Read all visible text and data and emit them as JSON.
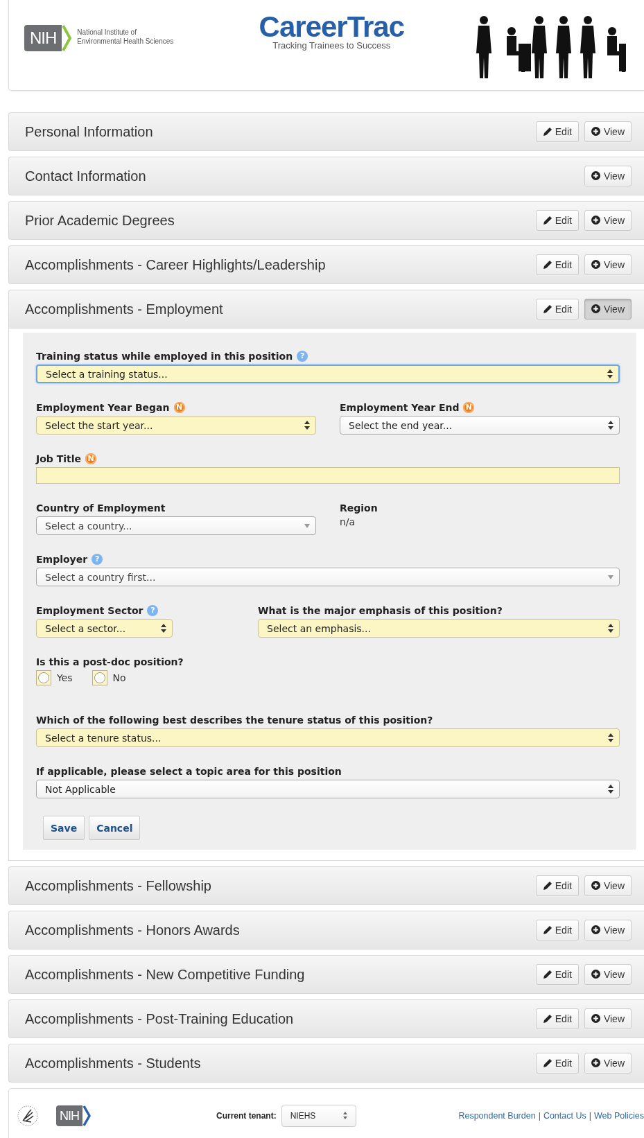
{
  "header": {
    "org_logo": "NIH",
    "org_name_lines": [
      "National Institute of",
      "Environmental Health Sciences"
    ],
    "app_title": "CareerTrac",
    "tagline": "Tracking Trainees to Success"
  },
  "sections": [
    {
      "title": "Personal Information",
      "expanded": false,
      "buttons": [
        {
          "kind": "edit",
          "label": "Edit",
          "pressed": false
        },
        {
          "kind": "view",
          "label": "View",
          "pressed": false
        }
      ]
    },
    {
      "title": "Contact Information",
      "expanded": false,
      "buttons": [
        {
          "kind": "view",
          "label": "View",
          "pressed": false
        }
      ]
    },
    {
      "title": "Prior Academic Degrees",
      "expanded": false,
      "buttons": [
        {
          "kind": "edit",
          "label": "Edit",
          "pressed": false
        },
        {
          "kind": "view",
          "label": "View",
          "pressed": false
        }
      ]
    },
    {
      "title": "Accomplishments - Career Highlights/Leadership",
      "expanded": false,
      "buttons": [
        {
          "kind": "edit",
          "label": "Edit",
          "pressed": false
        },
        {
          "kind": "view",
          "label": "View",
          "pressed": false
        }
      ]
    },
    {
      "title": "Accomplishments - Employment",
      "expanded": true,
      "buttons": [
        {
          "kind": "edit",
          "label": "Edit",
          "pressed": false
        },
        {
          "kind": "view",
          "label": "View",
          "pressed": true
        }
      ],
      "form": {
        "rows": [
          {
            "fields": [
              {
                "kind": "select",
                "label": "Training status while employed in this position",
                "marker": {
                  "kind": "help",
                  "text": "?"
                },
                "value": "Select a training status...",
                "highlighted": true,
                "focused": true
              }
            ]
          },
          {
            "fields": [
              {
                "kind": "select",
                "label": "Employment Year Began",
                "marker": {
                  "kind": "new",
                  "text": "N"
                },
                "value": "Select the start year...",
                "highlighted": true,
                "focused": false
              },
              {
                "kind": "select",
                "label": "Employment Year End",
                "marker": {
                  "kind": "new",
                  "text": "N"
                },
                "value": "Select the end year...",
                "highlighted": false,
                "focused": false
              }
            ]
          },
          {
            "fields": [
              {
                "kind": "text",
                "label": "Job Title",
                "marker": {
                  "kind": "new",
                  "text": "N"
                },
                "highlighted": true,
                "focused": false
              }
            ]
          },
          {
            "fields": [
              {
                "kind": "combo",
                "label": "Country of Employment",
                "value": "Select a country...",
                "highlighted": false,
                "focused": false
              },
              {
                "kind": "static",
                "label": "Region",
                "value": "n/a"
              }
            ]
          },
          {
            "fields": [
              {
                "kind": "combo",
                "label": "Employer",
                "marker": {
                  "kind": "help",
                  "text": "?"
                },
                "value": "Select a country first...",
                "highlighted": false,
                "focused": false
              }
            ]
          },
          {
            "fields": [
              {
                "kind": "select",
                "label": "Employment Sector",
                "marker": {
                  "kind": "help",
                  "text": "?"
                },
                "value": "Select a sector...",
                "highlighted": true,
                "focused": false
              },
              {
                "kind": "select",
                "label": "What is the major emphasis of this position?",
                "value": "Select an emphasis...",
                "highlighted": true,
                "focused": false
              }
            ]
          },
          {
            "fields": [
              {
                "kind": "radio",
                "label": "Is this a post-doc position?",
                "options": [
                  {
                    "label": "Yes",
                    "selected": false
                  },
                  {
                    "label": "No",
                    "selected": false
                  }
                ]
              }
            ]
          },
          {
            "fields": [
              {
                "kind": "select",
                "label": "Which of the following best describes the tenure status of this position?",
                "value": "Select a tenure status...",
                "highlighted": true,
                "focused": false
              }
            ]
          },
          {
            "fields": [
              {
                "kind": "select",
                "label": "If applicable, please select a topic area for this position",
                "value": "Not Applicable",
                "highlighted": false,
                "focused": false
              }
            ]
          }
        ],
        "actions": [
          {
            "label": "Save"
          },
          {
            "label": "Cancel"
          }
        ]
      }
    },
    {
      "title": "Accomplishments - Fellowship",
      "expanded": false,
      "buttons": [
        {
          "kind": "edit",
          "label": "Edit",
          "pressed": false
        },
        {
          "kind": "view",
          "label": "View",
          "pressed": false
        }
      ]
    },
    {
      "title": "Accomplishments - Honors Awards",
      "expanded": false,
      "buttons": [
        {
          "kind": "edit",
          "label": "Edit",
          "pressed": false
        },
        {
          "kind": "view",
          "label": "View",
          "pressed": false
        }
      ]
    },
    {
      "title": "Accomplishments - New Competitive Funding",
      "expanded": false,
      "buttons": [
        {
          "kind": "edit",
          "label": "Edit",
          "pressed": false
        },
        {
          "kind": "view",
          "label": "View",
          "pressed": false
        }
      ]
    },
    {
      "title": "Accomplishments - Post-Training Education",
      "expanded": false,
      "buttons": [
        {
          "kind": "edit",
          "label": "Edit",
          "pressed": false
        },
        {
          "kind": "view",
          "label": "View",
          "pressed": false
        }
      ]
    },
    {
      "title": "Accomplishments - Students",
      "expanded": false,
      "buttons": [
        {
          "kind": "edit",
          "label": "Edit",
          "pressed": false
        },
        {
          "kind": "view",
          "label": "View",
          "pressed": false
        }
      ]
    }
  ],
  "footer": {
    "org_logo": "NIH",
    "tenant_label": "Current tenant:",
    "tenant_value": "NIEHS",
    "links": [
      {
        "kind": "link",
        "text": "Respondent Burden"
      },
      {
        "kind": "separator",
        "text": "|"
      },
      {
        "kind": "link",
        "text": "Contact Us"
      },
      {
        "kind": "separator",
        "text": "|"
      },
      {
        "kind": "link",
        "text": "Web Policies"
      }
    ]
  }
}
